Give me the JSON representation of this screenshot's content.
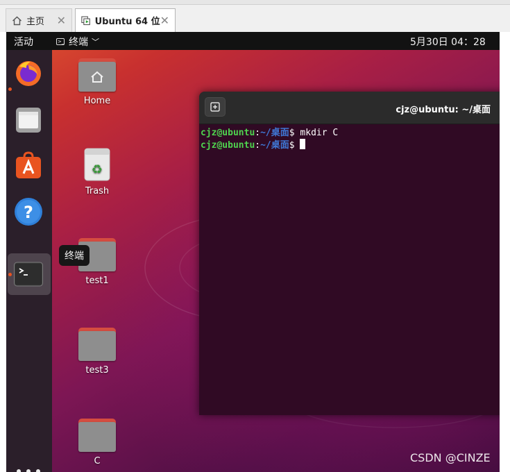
{
  "vm_tabs": [
    {
      "label": "主页",
      "icon": "home-icon"
    },
    {
      "label": "Ubuntu 64 位",
      "icon": "vm-icon"
    }
  ],
  "topbar": {
    "activities": "活动",
    "app_menu": "终端",
    "clock": "5月30日  04：28"
  },
  "dock": {
    "items": [
      "firefox-icon",
      "files-icon",
      "software-icon",
      "help-icon",
      "terminal-icon"
    ],
    "tooltip": "终端"
  },
  "desktop": {
    "icons": [
      {
        "label": "Home",
        "icon": "home-folder-icon"
      },
      {
        "label": "Trash",
        "icon": "trash-icon"
      },
      {
        "label": "test1",
        "icon": "folder-icon"
      },
      {
        "label": "test3",
        "icon": "folder-icon"
      },
      {
        "label": "C",
        "icon": "folder-icon"
      }
    ]
  },
  "terminal": {
    "title": "cjz@ubuntu: ~/桌面",
    "lines": [
      {
        "user": "cjz@ubuntu",
        "sep": ":",
        "path": "~/桌面",
        "dollar": "$ ",
        "cmd": "mkdir C"
      },
      {
        "user": "cjz@ubuntu",
        "sep": ":",
        "path": "~/桌面",
        "dollar": "$ ",
        "cmd": ""
      }
    ]
  },
  "watermark": "CSDN @CINZE",
  "colors": {
    "accent": "#e95420",
    "terminal_bg": "#300a24",
    "prompt_user": "#4fd34f",
    "prompt_path": "#3f78d6"
  }
}
